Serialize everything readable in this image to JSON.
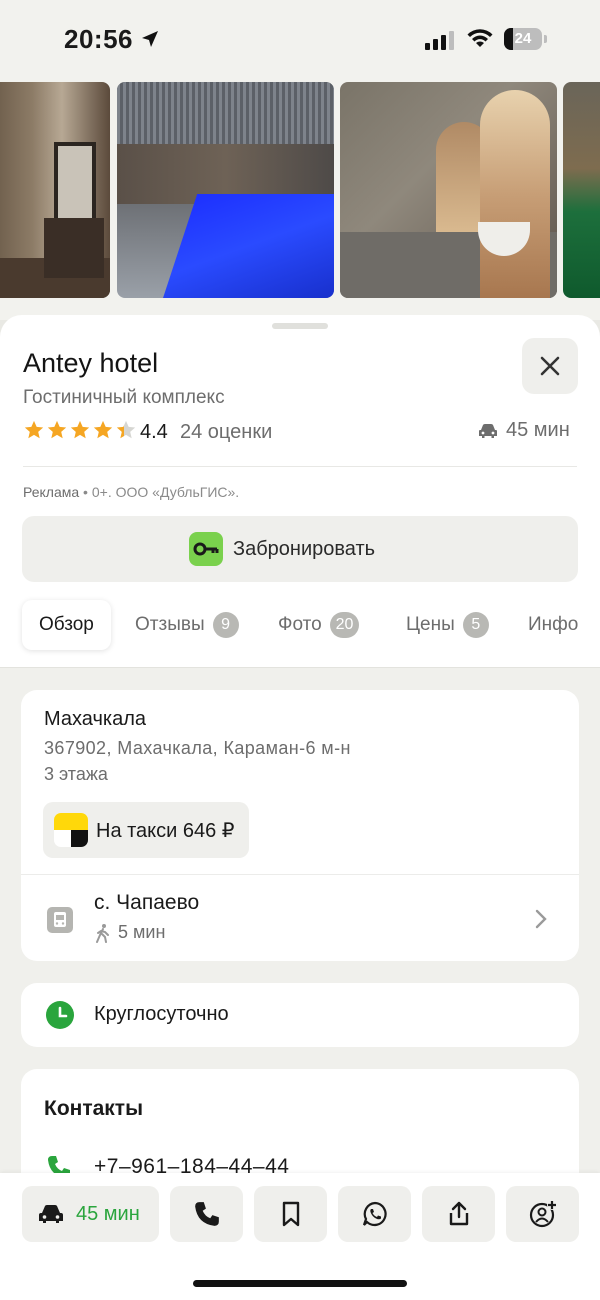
{
  "status_bar": {
    "time": "20:56",
    "battery": "24",
    "battery_level": 0.24
  },
  "place": {
    "name": "Antey hotel",
    "category": "Гостиничный комплекс",
    "rating": "4.4",
    "rating_value": 4.4,
    "reviews": "24 оценки",
    "drive_time": "45 мин"
  },
  "ad": {
    "label": "Реклама",
    "text": " • 0+. ООО «ДубльГИС»."
  },
  "booking": {
    "label": "Забронировать"
  },
  "tabs": [
    {
      "label": "Обзор",
      "count": ""
    },
    {
      "label": "Отзывы",
      "count": "9"
    },
    {
      "label": "Фото",
      "count": "20"
    },
    {
      "label": "Цены",
      "count": "5"
    },
    {
      "label": "Инфо",
      "count": ""
    }
  ],
  "address": {
    "city": "Махачкала",
    "line": "367902, Махачкала, Караман-6 м-н",
    "floors": "3 этажа",
    "taxi": "На такси 646 ₽"
  },
  "transit": {
    "stop": "с. Чапаево",
    "walk": "5 мин"
  },
  "hours": {
    "text": "Круглосуточно"
  },
  "contacts": {
    "title": "Контакты",
    "phone": "+7‒961‒184‒44‒44"
  },
  "action_bar": {
    "route_label": "45 мин"
  },
  "colors": {
    "accent_green": "#2aa53d",
    "star": "#f5a623",
    "booking_key": "#7ad14d"
  }
}
